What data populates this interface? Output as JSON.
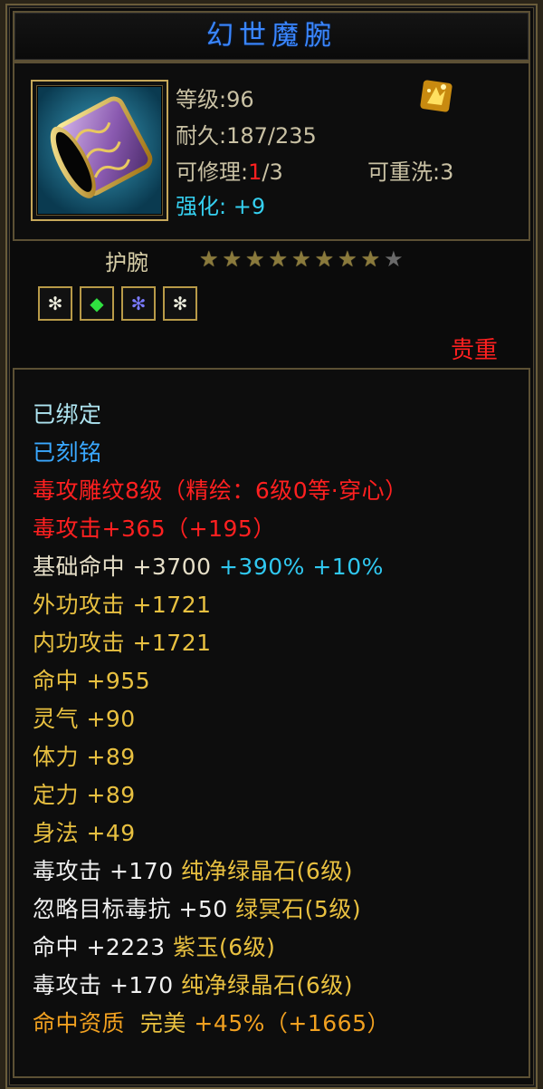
{
  "item": {
    "name": "幻世魔腕",
    "level_label": "等级:96",
    "durability_label": "耐久:187/235",
    "repair_prefix": "可修理:",
    "repair_current": "1",
    "repair_suffix": "/3",
    "rewash_label": "可重洗:3",
    "enhance_label": "强化: ",
    "enhance_value": "+9",
    "slot_type": "护腕",
    "stars_filled": 8,
    "stars_total": 9,
    "rarity": "贵重",
    "gem_icons": [
      "white-gem-icon",
      "green-gem-icon",
      "purple-gem-icon",
      "white-gem-icon"
    ]
  },
  "attributes": {
    "bound": "已绑定",
    "engraved": "已刻铭",
    "carving": "毒攻雕纹8级（精绘：6级0等·穿心）",
    "poison_attack": "毒攻击+365（+195）",
    "base_hit_label": "基础命中 +3700",
    "base_hit_pct1": "+390%",
    "base_hit_pct2": "+10%",
    "outer_attack": "外功攻击 +1721",
    "inner_attack": "内功攻击 +1721",
    "hit": "命中 +955",
    "spirit": "灵气 +90",
    "stamina": "体力 +89",
    "focus": "定力 +89",
    "agility": "身法 +49",
    "gem1_stat": "毒攻击 +170",
    "gem1_name": "纯净绿晶石(6级)",
    "gem2_stat": "忽略目标毒抗 +50",
    "gem2_name": "绿冥石(5级)",
    "gem3_stat": "命中 +2223",
    "gem3_name": "紫玉(6级)",
    "gem4_stat": "毒攻击 +170",
    "gem4_name": "纯净绿晶石(6级)",
    "quality_label": "命中资质",
    "quality_grade": "完美",
    "quality_value": "+45%（+1665）"
  },
  "colors": {
    "title": "#3a86ff",
    "rarity": "#ff2020",
    "stat_yellow": "#e8c040",
    "quality_orange": "#f0a020"
  }
}
